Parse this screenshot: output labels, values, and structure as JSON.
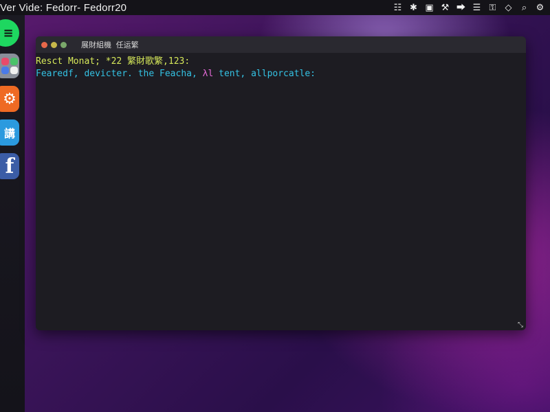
{
  "topbar": {
    "title": "Ver Vide: Fedorr- Fedorr20",
    "tray_icons": [
      {
        "name": "grid-icon",
        "glyph": "☷"
      },
      {
        "name": "bluetooth-icon",
        "glyph": "✱"
      },
      {
        "name": "camera-icon",
        "glyph": "▣"
      },
      {
        "name": "tools-icon",
        "glyph": "⚒"
      },
      {
        "name": "share-icon",
        "glyph": "⮕"
      },
      {
        "name": "menu-icon",
        "glyph": "☰"
      },
      {
        "name": "lock-icon",
        "glyph": "⚿"
      },
      {
        "name": "diamond-icon",
        "glyph": "◇"
      },
      {
        "name": "search-icon",
        "glyph": "⌕"
      },
      {
        "name": "settings-icon",
        "glyph": "⚙"
      }
    ]
  },
  "dock": {
    "items": [
      {
        "name": "spotify",
        "glyph": "≡"
      },
      {
        "name": "app-grid",
        "glyph": ""
      },
      {
        "name": "ubuntu",
        "glyph": "⚙"
      },
      {
        "name": "chat",
        "glyph": "講"
      },
      {
        "name": "facebook",
        "glyph": "f"
      }
    ]
  },
  "terminal": {
    "title": "展財組機 任运繁",
    "line1": "Resct Monat; *22 繁財歌繁,123:",
    "line2_a": "Fearedf, devicter. the Feacha,",
    "line2_b": "λl",
    "line2_c": " tent, allporcatle:",
    "resize_glyph": "⤡"
  },
  "colors": {
    "prompt_yellow": "#d6e85a",
    "output_cyan": "#34c2e4",
    "output_magenta": "#e46ad8"
  }
}
